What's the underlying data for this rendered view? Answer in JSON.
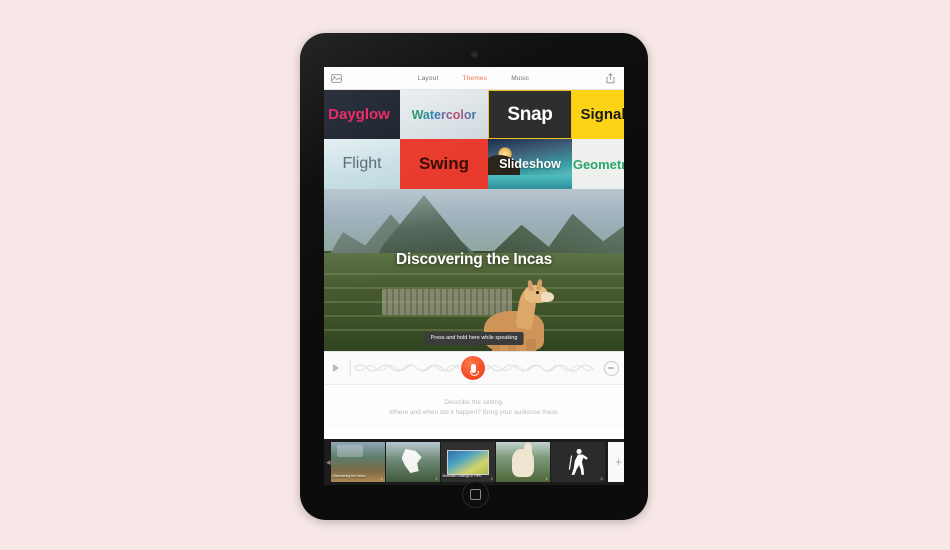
{
  "background_color": "#f7e8e7",
  "device": {
    "kind": "tablet",
    "bezel_color": "#0c0c0c",
    "camera_label": "front-camera",
    "home_button_label": "home-button"
  },
  "toolbar": {
    "library_icon": "library-icon",
    "share_icon": "share-icon",
    "tabs": [
      {
        "label": "Layout",
        "active": false
      },
      {
        "label": "Themes",
        "active": true
      },
      {
        "label": "Music",
        "active": false
      }
    ],
    "active_tab_color": "#f07040"
  },
  "themes": {
    "selected": "Snap",
    "selection_border_color": "#f3c21c",
    "rows": [
      [
        {
          "label": "Dayglow",
          "text_color": "#ef2b6a",
          "bg_color": "#1d2430",
          "selected": false
        },
        {
          "label": "Watercolor",
          "text_color": "#2f7fb8",
          "bg_color": "#e3eaee",
          "selected": false
        },
        {
          "label": "Snap",
          "text_color": "#ffffff",
          "bg_color": "#2b2b2b",
          "selected": true
        },
        {
          "label": "Signal",
          "text_color": "#1b1b1b",
          "bg_color": "#fcd414",
          "selected": false
        }
      ],
      [
        {
          "label": "Flight",
          "text_color": "#5c6e74",
          "bg_color": "#cfe3e8",
          "selected": false
        },
        {
          "label": "Swing",
          "text_color": "#3b0d09",
          "bg_color": "#e8392c",
          "selected": false
        },
        {
          "label": "Slideshow",
          "text_color": "#ffffff",
          "bg_color": "#3ba3a8",
          "selected": false
        },
        {
          "label": "Geometric",
          "text_color": "#2aa86a",
          "bg_color": "#eef0ee",
          "selected": false
        }
      ]
    ]
  },
  "hero": {
    "title": "Discovering the Incas",
    "image_subject": "machu-picchu-with-llama",
    "tooltip": "Press and hold here while speaking"
  },
  "audio": {
    "play_icon": "play-icon",
    "record_icon": "microphone-icon",
    "record_button_color": "#f4502a",
    "loop_icon": "loop-icon"
  },
  "hint": {
    "line1": "Describe the setting.",
    "line2": "Where and when did it happen? Bring your audience there."
  },
  "filmstrip": {
    "prev_icon": "previous-icon",
    "add_label": "+",
    "items": [
      {
        "name": "thumb-title-card",
        "caption": "Discovering the Incas",
        "index": "1"
      },
      {
        "name": "thumb-peru-map",
        "caption": "",
        "index": "2"
      },
      {
        "name": "thumb-map-detail",
        "caption": "Mountain Settings in Peru",
        "index": "3"
      },
      {
        "name": "thumb-llama",
        "caption": "",
        "index": "4"
      },
      {
        "name": "thumb-hiker-icon",
        "caption": "",
        "index": "5"
      }
    ]
  }
}
